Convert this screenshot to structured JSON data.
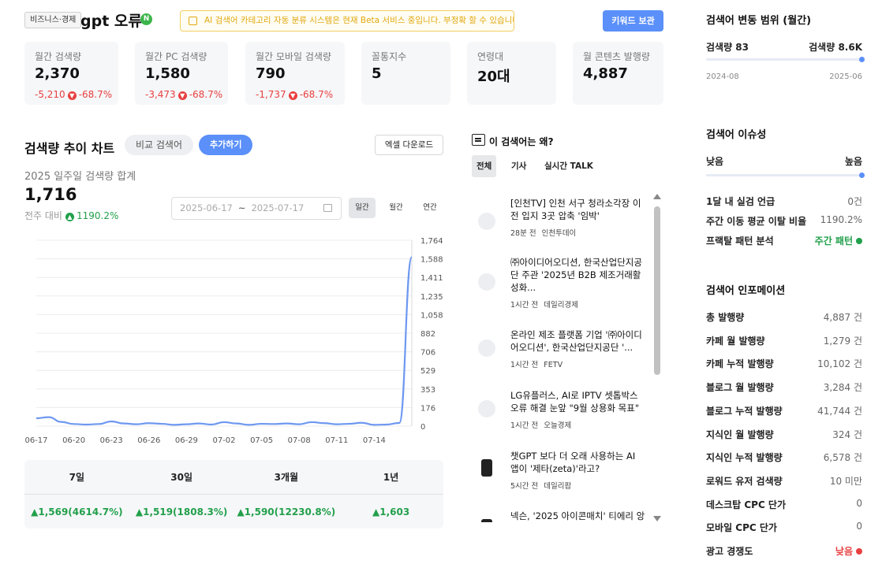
{
  "header": {
    "category": "비즈니스·경제",
    "keyword": "gpt 오류",
    "n_badge": "N",
    "beta_notice": "AI 검색어 카테고리 자동 분류 시스템은 현재 Beta 서비스 중입니다. 부정확 할 수 있습니다.",
    "keep_button": "키워드 보관"
  },
  "stats": [
    {
      "label": "월간 검색량",
      "value": "2,370",
      "delta": "-5,210",
      "pct": "-68.7%"
    },
    {
      "label": "월간 PC 검색량",
      "value": "1,580",
      "delta": "-3,473",
      "pct": "-68.7%"
    },
    {
      "label": "월간 모바일 검색량",
      "value": "790",
      "delta": "-1,737",
      "pct": "-68.7%"
    },
    {
      "label": "꼴통지수",
      "value": "5"
    },
    {
      "label": "연령대",
      "value": "20대"
    },
    {
      "label": "월 콘텐츠 발행량",
      "value": "4,887"
    }
  ],
  "trend": {
    "title": "검색량 추이 차트",
    "compare_button": "비교 검색어",
    "add_button": "추가하기",
    "excel_button": "엑셀 다운로드",
    "sum_label": "2025 일주일 검색량 합계",
    "sum_value": "1,716",
    "wow_label": "전주 대비",
    "wow_value": "1190.2%",
    "date_from": "2025-06-17",
    "date_sep": "~",
    "date_to": "2025-07-17",
    "periods": [
      "일간",
      "월간",
      "연간"
    ]
  },
  "chart_data": {
    "type": "line",
    "x": [
      "06-17",
      "06-18",
      "06-19",
      "06-20",
      "06-21",
      "06-22",
      "06-23",
      "06-24",
      "06-25",
      "06-26",
      "06-27",
      "06-28",
      "06-29",
      "06-30",
      "07-01",
      "07-02",
      "07-03",
      "07-04",
      "07-05",
      "07-06",
      "07-07",
      "07-08",
      "07-09",
      "07-10",
      "07-11",
      "07-12",
      "07-13",
      "07-14",
      "07-15",
      "07-16",
      "07-17"
    ],
    "x_ticks": [
      "06-17",
      "06-20",
      "06-23",
      "06-26",
      "06-29",
      "07-02",
      "07-05",
      "07-08",
      "07-11",
      "07-14"
    ],
    "y_ticks": [
      "0",
      "176",
      "353",
      "529",
      "706",
      "882",
      "1,058",
      "1,235",
      "1,411",
      "1,588",
      "1,764"
    ],
    "values": [
      75,
      85,
      40,
      20,
      15,
      20,
      45,
      25,
      18,
      28,
      22,
      12,
      18,
      25,
      15,
      38,
      25,
      12,
      22,
      20,
      25,
      18,
      38,
      28,
      18,
      22,
      32,
      12,
      15,
      30,
      1603
    ],
    "ylim": [
      0,
      1764
    ],
    "grid": true,
    "color": "#6e98f0"
  },
  "period_table": {
    "headers": [
      "7일",
      "30일",
      "3개월",
      "1년"
    ],
    "values": [
      "▲1,569(4614.7%)",
      "▲1,519(1808.3%)",
      "▲1,590(12230.8%)",
      "▲1,603"
    ]
  },
  "news": {
    "heading": "이 검색어는 왜?",
    "tabs": [
      "전체",
      "기사",
      "실시간 TALK"
    ],
    "items": [
      {
        "title": "[인천TV] 인천 서구 청라소각장 이전 입지 3곳 압축 '임박'",
        "time": "28분 전",
        "source": "인천투데이"
      },
      {
        "title": "㈜아이디어오디션, 한국산업단지공단 주관 '2025년 B2B 제조거래활성화...",
        "time": "1시간 전",
        "source": "데일리경제"
      },
      {
        "title": "온라인 제조 플랫폼 기업 '㈜아이디어오디션', 한국산업단지공단 '...",
        "time": "1시간 전",
        "source": "FETV"
      },
      {
        "title": "LG유플러스, AI로 IPTV 셋톱박스 오류 해결 눈앞 \"9월 상용화 목표\"",
        "time": "1시간 전",
        "source": "오늘경제"
      },
      {
        "title": "챗GPT 보다 더 오래 사용하는 AI 앱이 '제타(zeta)'라고?",
        "time": "5시간 전",
        "source": "데일리팝"
      },
      {
        "title": "넥슨, '2025 아이콘매치' 티에리 앙",
        "time": "",
        "source": ""
      }
    ]
  },
  "range_panel": {
    "title": "검색어 변동 범위 (월간)",
    "min_label": "검색량 83",
    "max_label": "검색량 8.6K",
    "start_date": "2024-08",
    "end_date": "2025-06"
  },
  "issue_panel": {
    "title": "검색어 이슈성",
    "low": "낮음",
    "high": "높음",
    "rows": [
      {
        "label": "1달 내 실검 언급",
        "value": "0건"
      },
      {
        "label": "주간 이동 평균 이탈 비율",
        "value": "1190.2%"
      },
      {
        "label": "프랙탈 패턴 분석",
        "value": "주간 패턴"
      }
    ]
  },
  "info_panel": {
    "title": "검색어 인포메이션",
    "rows": [
      {
        "label": "총 발행량",
        "value": "4,887 건"
      },
      {
        "label": "카페 월 발행량",
        "value": "1,279 건"
      },
      {
        "label": "카페 누적 발행량",
        "value": "10,102 건"
      },
      {
        "label": "블로그 월 발행량",
        "value": "3,284 건"
      },
      {
        "label": "블로그 누적 발행량",
        "value": "41,744 건"
      },
      {
        "label": "지식인 월 발행량",
        "value": "324 건"
      },
      {
        "label": "지식인 누적 발행량",
        "value": "6,578 건"
      },
      {
        "label": "로워드 유저 검색량",
        "value": "10 미만"
      },
      {
        "label": "데스크탑 CPC 단가",
        "value": "0"
      },
      {
        "label": "모바일 CPC 단가",
        "value": "0"
      },
      {
        "label": "광고 경쟁도",
        "value": "낮음"
      }
    ]
  },
  "colors": {
    "accent": "#5b8ff9",
    "up": "#22a04b",
    "down": "#e84040"
  }
}
